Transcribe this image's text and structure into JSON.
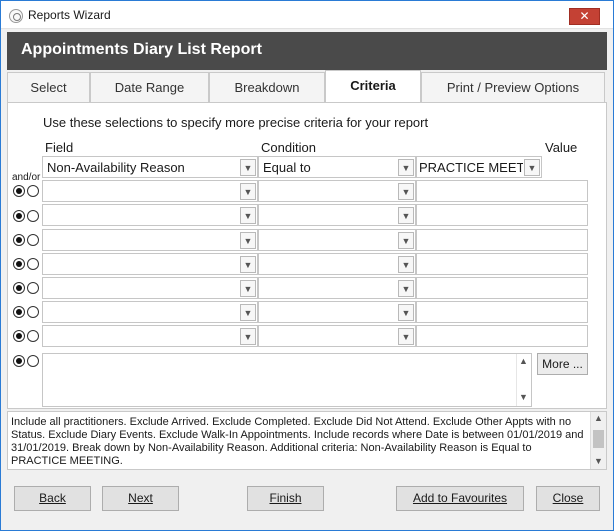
{
  "window": {
    "title": "Reports Wizard",
    "close_glyph": "✕"
  },
  "header": {
    "title": "Appointments Diary List Report"
  },
  "tabs": [
    {
      "label": "Select"
    },
    {
      "label": "Date Range"
    },
    {
      "label": "Breakdown"
    },
    {
      "label": "Criteria",
      "active": true
    },
    {
      "label": "Print / Preview Options"
    }
  ],
  "criteria": {
    "instruction": "Use these selections to specify more precise criteria for your report",
    "field_header": "Field",
    "condition_header": "Condition",
    "value_header": "Value",
    "andor_label": "and/or",
    "rows": [
      {
        "field": "Non-Availability Reason",
        "condition": "Equal to",
        "value": "PRACTICE MEETIN"
      },
      {
        "field": "",
        "condition": "",
        "value": ""
      },
      {
        "field": "",
        "condition": "",
        "value": ""
      },
      {
        "field": "",
        "condition": "",
        "value": ""
      },
      {
        "field": "",
        "condition": "",
        "value": ""
      },
      {
        "field": "",
        "condition": "",
        "value": ""
      },
      {
        "field": "",
        "condition": "",
        "value": ""
      },
      {
        "field": "",
        "condition": "",
        "value": ""
      }
    ],
    "more_label": "More ..."
  },
  "summary": "Include all practitioners. Exclude Arrived. Exclude Completed. Exclude Did Not Attend. Exclude Other Appts with no Status. Exclude Diary Events. Exclude Walk-In Appointments. Include records where Date is between 01/01/2019 and 31/01/2019. Break down by Non-Availability Reason. Additional criteria: Non-Availability Reason is Equal to PRACTICE MEETING.",
  "buttons": {
    "back": "Back",
    "next": "Next",
    "finish": "Finish",
    "favourites": "Add to Favourites",
    "close": "Close"
  },
  "icons": {
    "dropdown": "chevron-down-icon",
    "close": "close-icon",
    "app": "app-icon"
  },
  "colors": {
    "header_band": "#4a4a4a",
    "close_button": "#c44134"
  }
}
